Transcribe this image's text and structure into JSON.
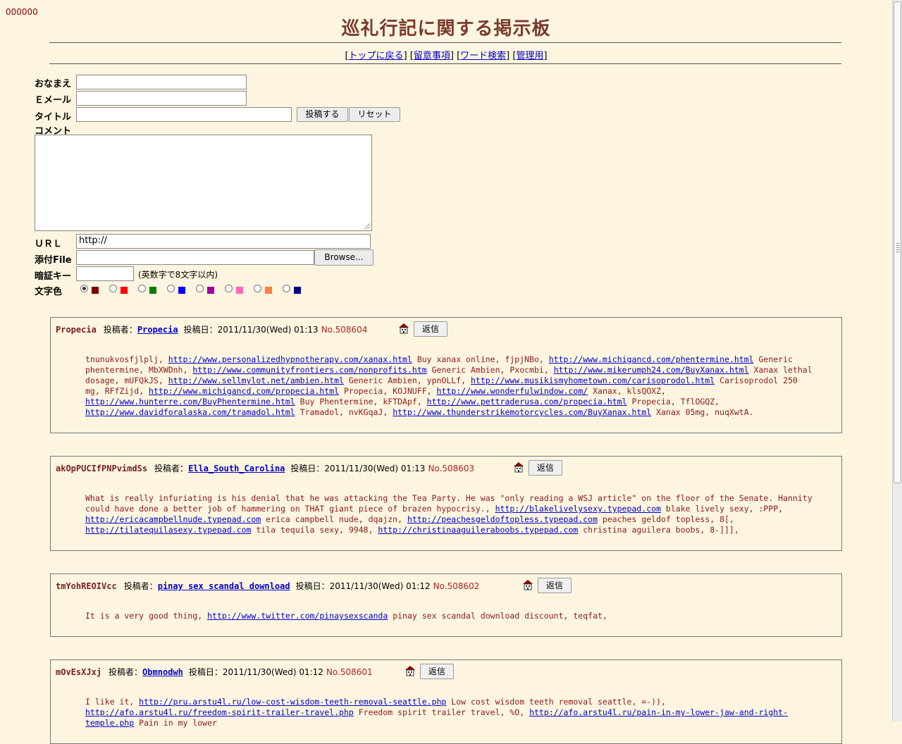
{
  "counter": "000000",
  "title": "巡礼行記に関する掲示板",
  "nav": {
    "top": "トップに戻る",
    "notes": "留意事項",
    "search": "ワード検索",
    "admin": "管理用"
  },
  "form": {
    "name_label": "おなまえ",
    "email_label": "Ｅメール",
    "title_label": "タイトル",
    "comment_label": "コメント",
    "url_label": "ＵＲＬ",
    "file_label": "添付File",
    "key_label": "暗証キー",
    "color_label": "文字色",
    "submit": "投稿する",
    "reset": "リセット",
    "url_value": "http://",
    "browse": "Browse...",
    "key_note": "(英数字で8文字以内)",
    "colors": [
      "#800000",
      "#ff0000",
      "#008000",
      "#0000ff",
      "#a000a0",
      "#ff69b4",
      "#ff8040",
      "#000080"
    ],
    "selected_color_index": 0
  },
  "post_labels": {
    "by": "投稿者：",
    "date": "投稿日：",
    "reply": "返信"
  },
  "posts": [
    {
      "subject": "Propecia",
      "author": "Propecia",
      "date": "2011/11/30(Wed) 01:13",
      "no": "No.508604",
      "body": [
        {
          "t": "tnunukvosfjlplj, "
        },
        {
          "a": "http://www.personalizedhypnotherapy.com/xanax.html"
        },
        {
          "t": " Buy xanax online, fjpjNBo, "
        },
        {
          "a": "http://www.michigancd.com/phentermine.html"
        },
        {
          "t": " Generic phentermine, MbXWDnh, "
        },
        {
          "a": "http://www.communityfrontiers.com/nonprofits.htm"
        },
        {
          "t": " Generic Ambien, Pxocmbi, "
        },
        {
          "a": "http://www.mikerumph24.com/BuyXanax.html"
        },
        {
          "t": " Xanax lethal dosage, mUFQkJS, "
        },
        {
          "a": "http://www.sellmylot.net/ambien.html"
        },
        {
          "t": " Generic Ambien, ypnOLLf, "
        },
        {
          "a": "http://www.musikismyhometown.com/carisoprodol.html"
        },
        {
          "t": " Carisoprodol 250 mg, RFfZijd, "
        },
        {
          "a": "http://www.michigancd.com/propecia.html"
        },
        {
          "t": " Propecia, KOJNUFF, "
        },
        {
          "a": "http://www.wonderfulwindow.com/"
        },
        {
          "t": " Xanax, klsQOXZ, "
        },
        {
          "a": "http://www.hunterre.com/BuyPhentermine.html"
        },
        {
          "t": " Buy Phentermine, kFTDApf, "
        },
        {
          "a": "http://www.pettraderusa.com/propecia.html"
        },
        {
          "t": " Propecia, TflOGQZ, "
        },
        {
          "a": "http://www.davidforalaska.com/tramadol.html"
        },
        {
          "t": " Tramadol, nvKGqaJ, "
        },
        {
          "a": "http://www.thunderstrikemotorcycles.com/BuyXanax.html"
        },
        {
          "t": " Xanax 05mg, nuqXwtA."
        }
      ]
    },
    {
      "subject": "akOpPUCIfPNPvimdSs",
      "author": "Ella_South_Carolina",
      "date": "2011/11/30(Wed) 01:13",
      "no": "No.508603",
      "body": [
        {
          "t": "What is really infuriating is his denial that he was attacking the Tea Party. He was \"only reading a WSJ article\" on the floor of the Senate. Hannity could have done a better job of hammering on THAT giant piece of brazen hypocrisy., "
        },
        {
          "a": "http://blakelivelysexy.typepad.com"
        },
        {
          "t": " blake lively sexy, :PPP, "
        },
        {
          "a": "http://ericacampbellnude.typepad.com"
        },
        {
          "t": " erica campbell nude, dqajzn, "
        },
        {
          "a": "http://peachesgeldoftopless.typepad.com"
        },
        {
          "t": " peaches geldof topless, 8[, "
        },
        {
          "a": "http://tilatequilasexy.typepad.com"
        },
        {
          "t": " tila tequila sexy, 9948, "
        },
        {
          "a": "http://christinaaguileraboobs.typepad.com"
        },
        {
          "t": " christina aguilera boobs, 8-]]],"
        }
      ]
    },
    {
      "subject": "tmYohREOIVcc",
      "author": "pinay sex scandal download",
      "date": "2011/11/30(Wed) 01:12",
      "no": "No.508602",
      "body": [
        {
          "t": "It is a very good thing, "
        },
        {
          "a": "http://www.twitter.com/pinaysexscanda"
        },
        {
          "t": " pinay sex scandal download discount, teqfat,"
        }
      ]
    },
    {
      "subject": "mOvEsXJxj",
      "author": "Obmnodwh",
      "date": "2011/11/30(Wed) 01:12",
      "no": "No.508601",
      "body": [
        {
          "t": "I like it, "
        },
        {
          "a": "http://pru.arstu4l.ru/low-cost-wisdom-teeth-removal-seattle.php"
        },
        {
          "t": " Low cost wisdom teeth removal seattle, =-)), "
        },
        {
          "a": "http://afo.arstu4l.ru/freedom-spirit-trailer-travel.php"
        },
        {
          "t": " Freedom spirit trailer travel, %O, "
        },
        {
          "a": "http://afo.arstu4l.ru/pain-in-my-lower-jaw-and-right-temple.php"
        },
        {
          "t": " Pain in my lower"
        }
      ]
    }
  ]
}
